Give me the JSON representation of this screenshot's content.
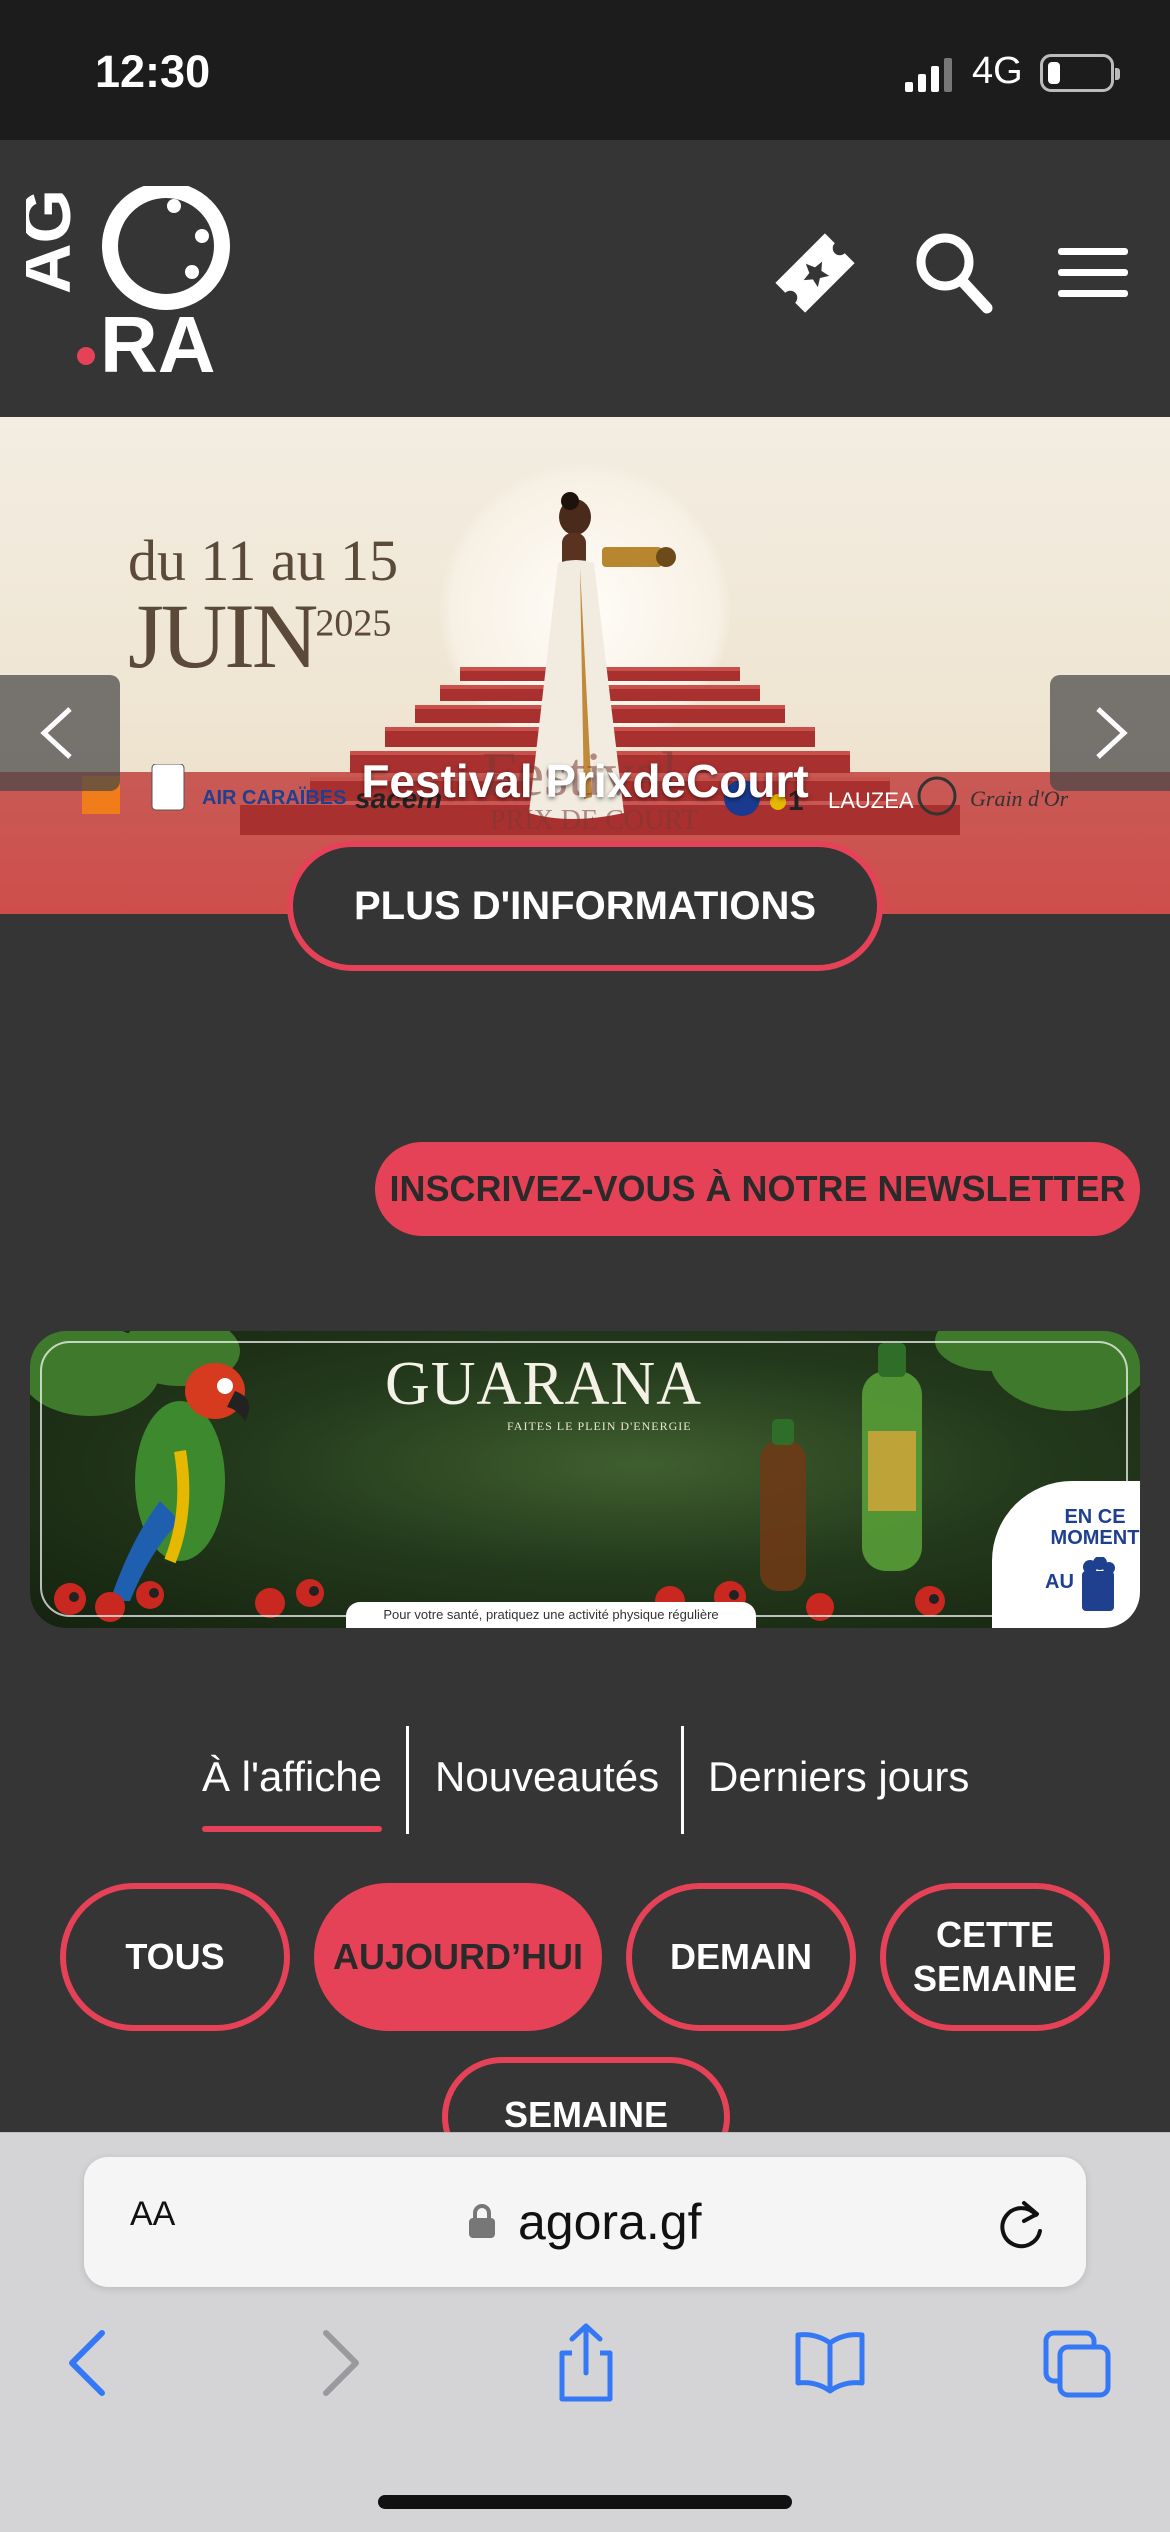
{
  "status_bar": {
    "time": "12:30",
    "network": "4G"
  },
  "header": {
    "logo_text": "AGORA",
    "icons": [
      "ticket-icon",
      "search-icon",
      "menu-icon"
    ]
  },
  "hero": {
    "date_line1": "du 11 au 15",
    "date_month": "JUIN",
    "date_year": "2025",
    "caption": "Festival PrixdeCourt",
    "more_button": "PLUS D'INFORMATIONS"
  },
  "newsletter_button": "INSCRIVEZ-VOUS À NOTRE NEWSLETTER",
  "ad": {
    "brand": "GUARANA",
    "tagline": "FAITES LE PLEIN D'ENERGIE",
    "footer": "Pour votre santé, pratiquez une activité physique régulière",
    "badge_line1": "EN CE MOMENT",
    "badge_line2": "AU",
    "badge_logo": "BAR POP"
  },
  "tabs": [
    {
      "label": "À l'affiche",
      "active": true
    },
    {
      "label": "Nouveautés",
      "active": false
    },
    {
      "label": "Derniers jours",
      "active": false
    }
  ],
  "filters": {
    "all": "TOUS",
    "today": "AUJOURD’HUI",
    "tomorrow": "DEMAIN",
    "this_week_1": "CETTE",
    "this_week_2": "SEMAINE",
    "next": "SEMAINE"
  },
  "browser": {
    "aa_label": "AA",
    "url": "agora.gf"
  },
  "colors": {
    "accent": "#e64257",
    "background": "#353535",
    "status_bar": "#1c1c1c"
  }
}
